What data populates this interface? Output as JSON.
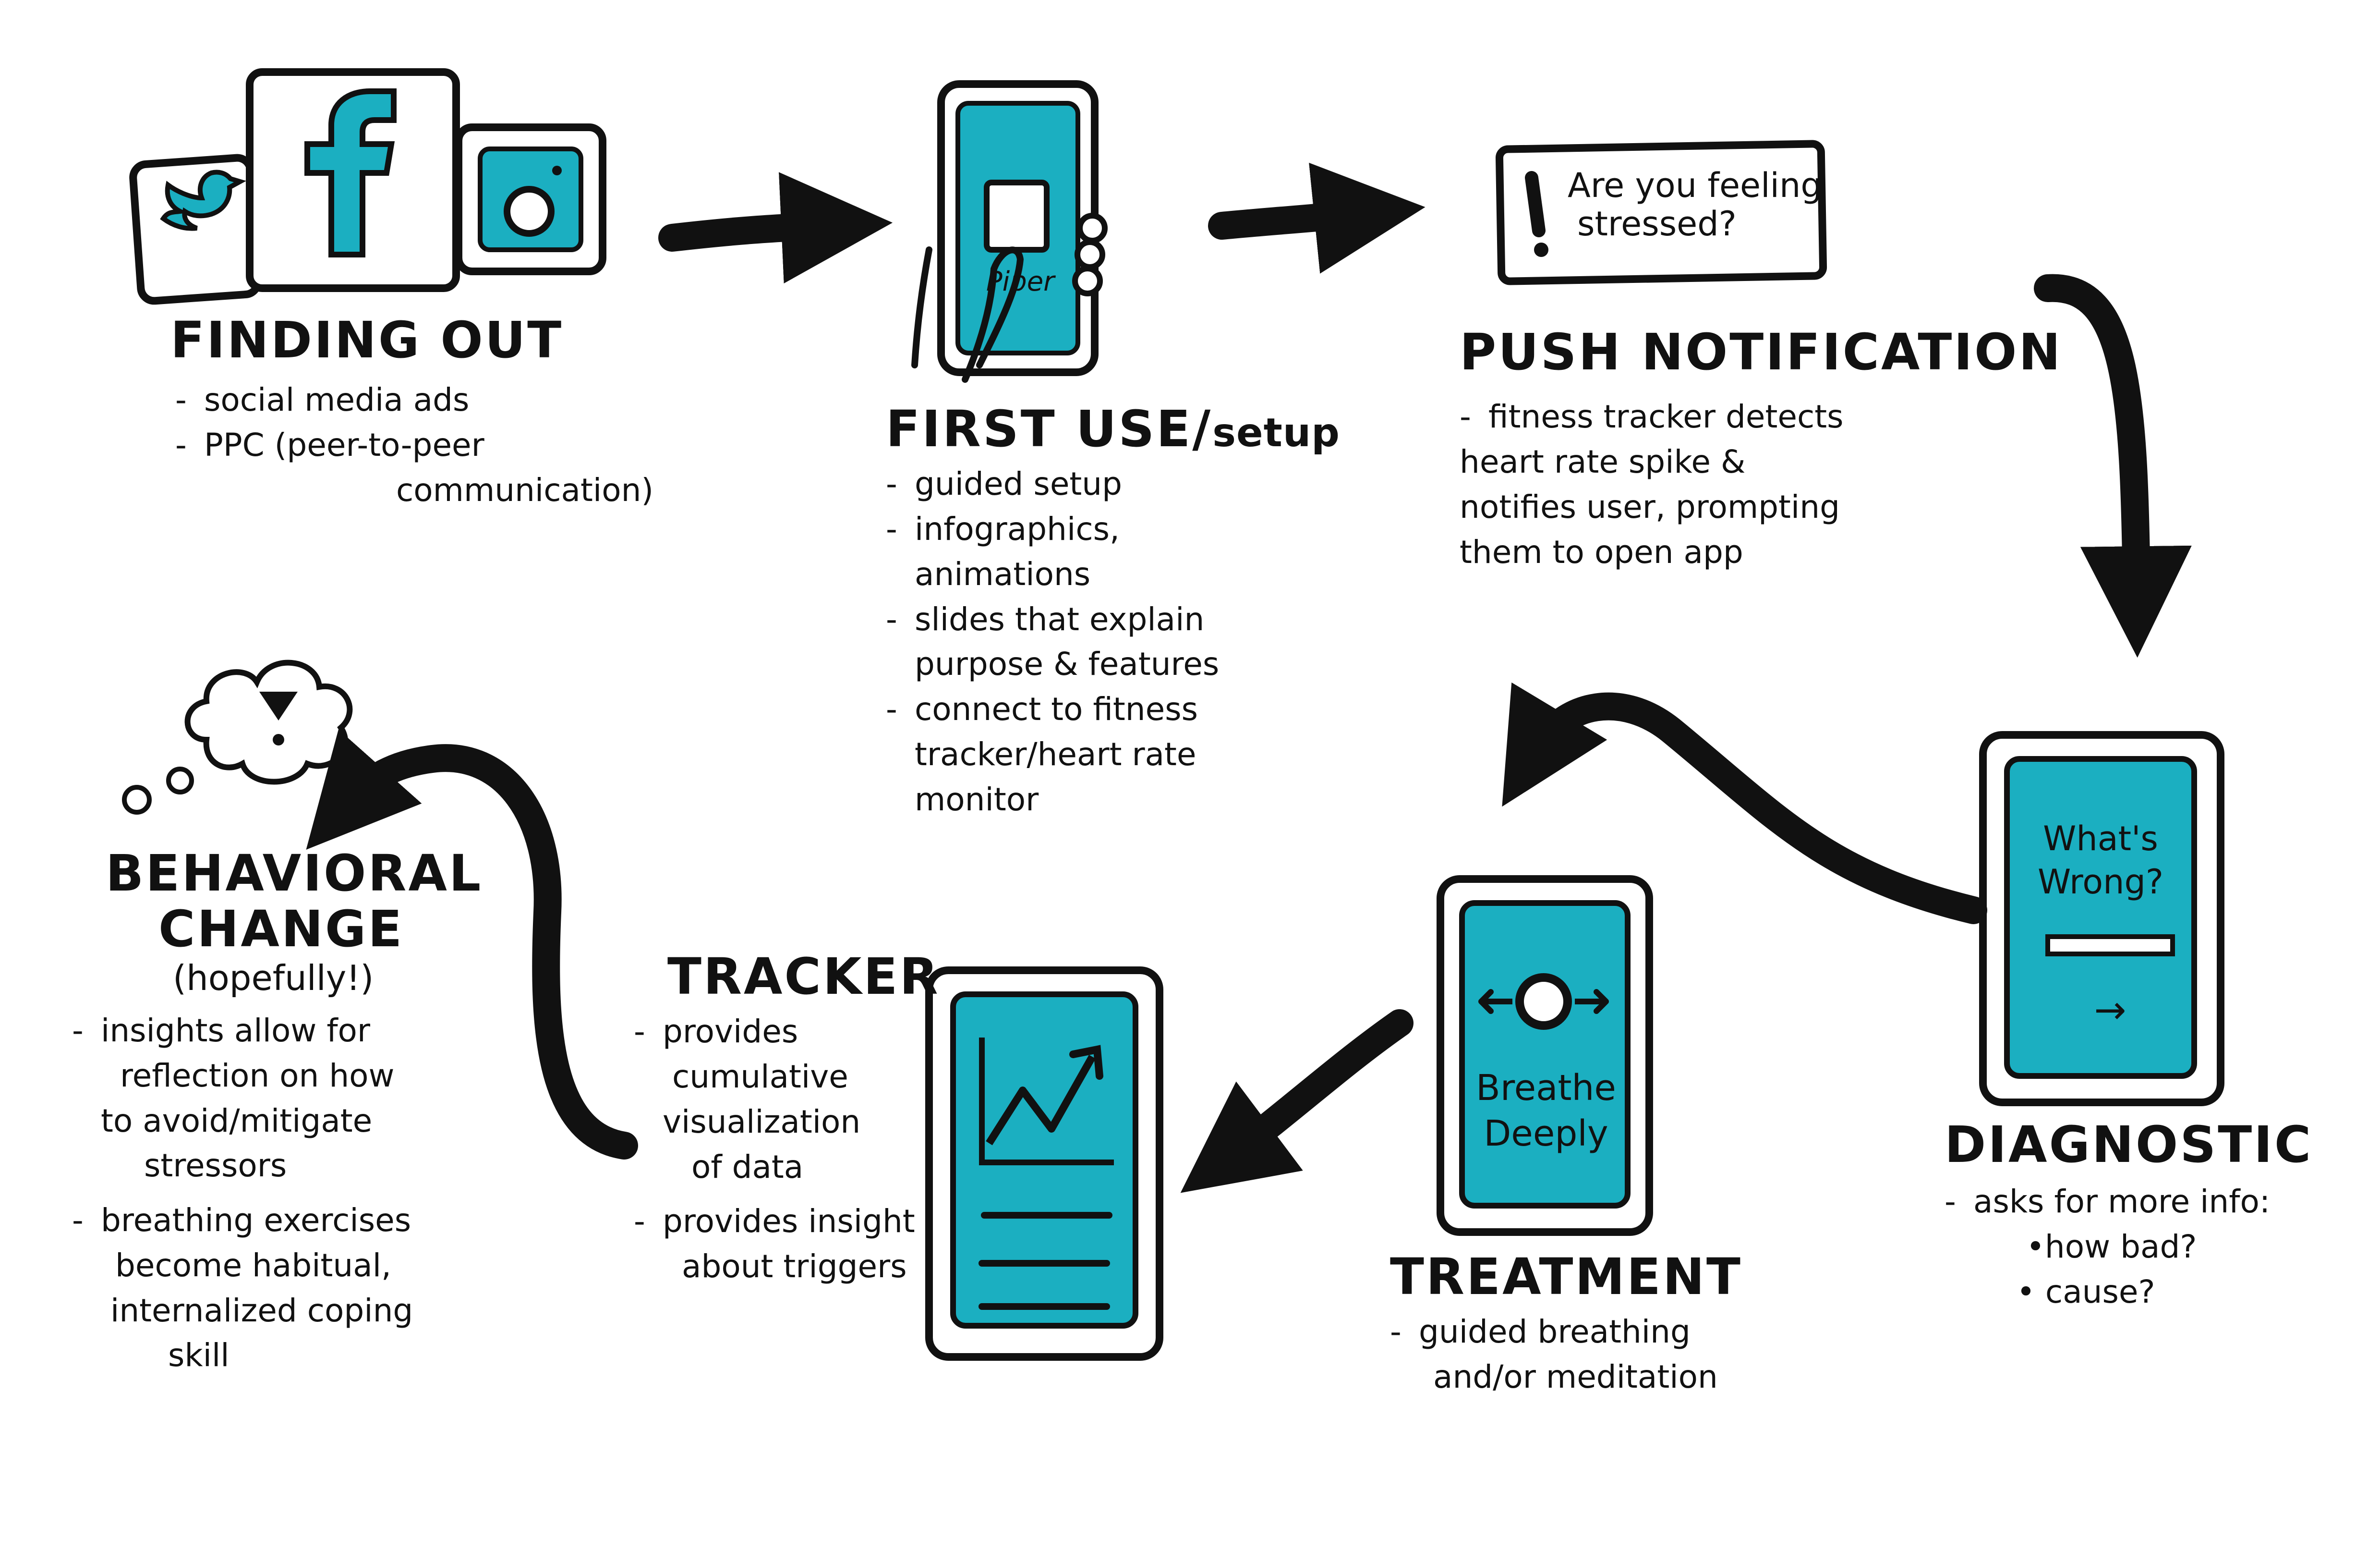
{
  "colors": {
    "accent": "#1BAFC1",
    "ink": "#111111",
    "paper": "#ffffff"
  },
  "icons": [
    "twitter-icon",
    "facebook-icon",
    "instagram-icon",
    "phone-icon",
    "notification-icon",
    "thought-bubble-icon",
    "chart-icon",
    "breathe-icon"
  ],
  "notification": {
    "line1": "Are you feeling",
    "line2": "stressed?"
  },
  "phone_labels": {
    "setup": "Piper",
    "diagnostic_line1": "What's",
    "diagnostic_line2": "Wrong?",
    "diagnostic_arrow": "→",
    "treatment_line1": "Breathe",
    "treatment_line2": "Deeply"
  },
  "stages": {
    "finding_out": {
      "title": "Finding Out",
      "items": [
        "social media ads",
        "PPC (peer-to-peer",
        "communication)"
      ]
    },
    "first_use": {
      "title": "First Use/",
      "title_suffix": "setup",
      "items": [
        "guided setup",
        "infographics,",
        "animations",
        "slides that explain",
        "purpose & features",
        "connect to fitness",
        "tracker/heart rate",
        "monitor"
      ]
    },
    "push_notification": {
      "title": "Push Notification",
      "items": [
        "fitness tracker detects",
        "heart rate spike &",
        "notifies user, prompting",
        "them to open app"
      ]
    },
    "diagnostic": {
      "title": "Diagnostic",
      "items": [
        "asks for more info:",
        "•how bad?",
        "• cause?"
      ]
    },
    "treatment": {
      "title": "Treatment",
      "items": [
        "guided breathing",
        "and/or meditation"
      ]
    },
    "tracker": {
      "title": "Tracker",
      "items": [
        "provides",
        "cumulative",
        "visualization",
        "of data",
        "provides insight",
        "about triggers"
      ]
    },
    "behavioral_change": {
      "title_line1": "Behavioral",
      "title_line2": "Change",
      "subtitle": "(hopefully!)",
      "items": [
        "insights allow for",
        "reflection on how",
        "to avoid/mitigate",
        "stressors",
        "breathing exercises",
        "become habitual,",
        "internalized coping",
        "skill"
      ]
    }
  }
}
